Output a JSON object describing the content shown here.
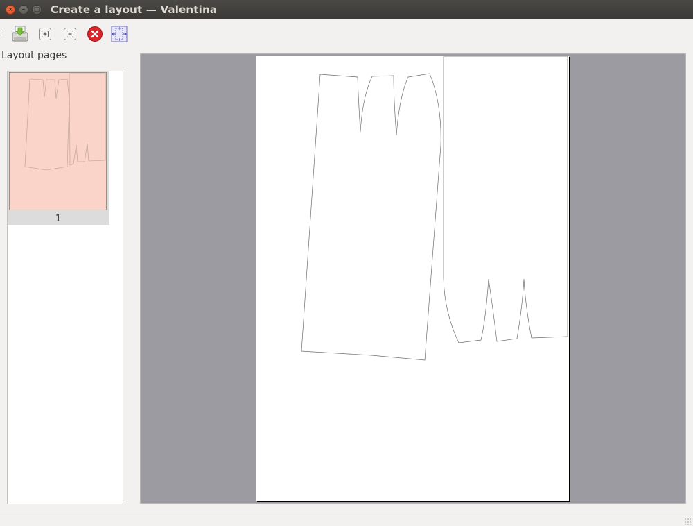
{
  "window": {
    "title": "Create a layout — Valentina"
  },
  "titlebar_buttons": {
    "close_glyph": "×",
    "minimize_glyph": "–",
    "maximize_glyph": "□"
  },
  "toolbar": {
    "items": [
      {
        "icon": "export-layout-icon"
      },
      {
        "icon": "zoom-in-icon"
      },
      {
        "icon": "zoom-out-icon"
      },
      {
        "icon": "cancel-icon"
      },
      {
        "icon": "zoom-fit-icon"
      }
    ]
  },
  "left_panel": {
    "title": "Layout pages",
    "pages": [
      {
        "label": "1",
        "selected": true
      }
    ]
  },
  "colors": {
    "thumbnail_fill": "#fad4c8",
    "scene_background": "#9c9ba1",
    "sheet": "#ffffff",
    "cancel_red": "#d8262b"
  }
}
